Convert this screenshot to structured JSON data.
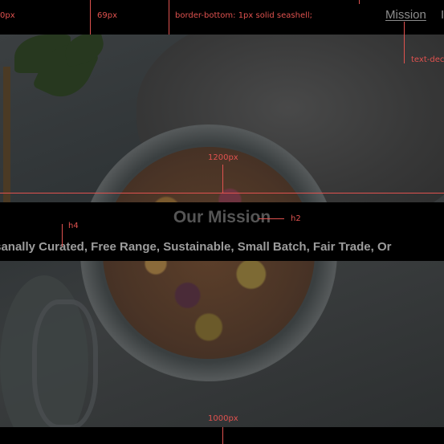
{
  "nav": {
    "mission_link": "Mission",
    "next_link_fragment": "I"
  },
  "hero": {
    "heading": "Our Mission",
    "tagline": "ed, Artisanally Curated, Free Range, Sustainable, Small Batch, Fair Trade, Or"
  },
  "annotations": {
    "left_px": "0px",
    "width_69": "69px",
    "border_bottom": "border-bottom: 1px solid seashell;",
    "text_decoration": "text-dec",
    "width_1200": "1200px",
    "h4_label": "h4",
    "h2_label": "h2",
    "width_1000": "1000px"
  },
  "colors": {
    "annotation": "#e0524f",
    "heading": "#555555",
    "tagline": "#9c9c9c",
    "nav_link": "#8d8d8d"
  }
}
